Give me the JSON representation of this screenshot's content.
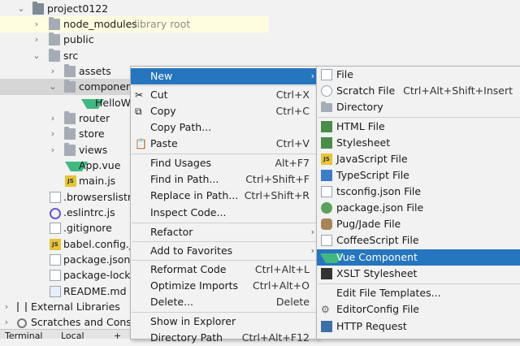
{
  "tree": {
    "rows": [
      {
        "label": "project0122"
      },
      {
        "label": "node_modules",
        "hint": "library root"
      },
      {
        "label": "public"
      },
      {
        "label": "src"
      },
      {
        "label": "assets"
      },
      {
        "label": "component"
      },
      {
        "label": "HelloWo"
      },
      {
        "label": "router"
      },
      {
        "label": "store"
      },
      {
        "label": "views"
      },
      {
        "label": "App.vue"
      },
      {
        "label": "main.js"
      },
      {
        "label": ".browserslistrc"
      },
      {
        "label": ".eslintrc.js"
      },
      {
        "label": ".gitignore"
      },
      {
        "label": "babel.config.js"
      },
      {
        "label": "package.json"
      },
      {
        "label": "package-lock.j"
      },
      {
        "label": "README.md"
      },
      {
        "label": "External Libraries"
      },
      {
        "label": "Scratches and Consol"
      }
    ]
  },
  "bottom": {
    "terminal": "Terminal",
    "local": "Local",
    "plus": "+"
  },
  "menu1": {
    "items": [
      {
        "label": "New",
        "shortcut": "",
        "submenu": "›"
      },
      {
        "label": "Cut",
        "shortcut": "Ctrl+X"
      },
      {
        "label": "Copy",
        "shortcut": "Ctrl+C"
      },
      {
        "label": "Copy Path...",
        "shortcut": ""
      },
      {
        "label": "Paste",
        "shortcut": "Ctrl+V"
      },
      {
        "label": "Find Usages",
        "shortcut": "Alt+F7"
      },
      {
        "label": "Find in Path...",
        "shortcut": "Ctrl+Shift+F"
      },
      {
        "label": "Replace in Path...",
        "shortcut": "Ctrl+Shift+R"
      },
      {
        "label": "Inspect Code...",
        "shortcut": ""
      },
      {
        "label": "Refactor",
        "shortcut": "",
        "submenu": "›"
      },
      {
        "label": "Add to Favorites",
        "shortcut": "",
        "submenu": "›"
      },
      {
        "label": "Reformat Code",
        "shortcut": "Ctrl+Alt+L"
      },
      {
        "label": "Optimize Imports",
        "shortcut": "Ctrl+Alt+O"
      },
      {
        "label": "Delete...",
        "shortcut": "Delete"
      },
      {
        "label": "Show in Explorer",
        "shortcut": ""
      },
      {
        "label": "Directory Path",
        "shortcut": "Ctrl+Alt+F12"
      }
    ]
  },
  "menu2": {
    "items": [
      {
        "label": "File",
        "shortcut": ""
      },
      {
        "label": "Scratch File",
        "shortcut": "Ctrl+Alt+Shift+Insert"
      },
      {
        "label": "Directory",
        "shortcut": ""
      },
      {
        "label": "HTML File",
        "shortcut": ""
      },
      {
        "label": "Stylesheet",
        "shortcut": ""
      },
      {
        "label": "JavaScript File",
        "shortcut": ""
      },
      {
        "label": "TypeScript File",
        "shortcut": ""
      },
      {
        "label": "tsconfig.json File",
        "shortcut": ""
      },
      {
        "label": "package.json File",
        "shortcut": ""
      },
      {
        "label": "Pug/Jade File",
        "shortcut": ""
      },
      {
        "label": "CoffeeScript File",
        "shortcut": ""
      },
      {
        "label": "Vue Component",
        "shortcut": ""
      },
      {
        "label": "XSLT Stylesheet",
        "shortcut": ""
      },
      {
        "label": "Edit File Templates...",
        "shortcut": ""
      },
      {
        "label": "EditorConfig File",
        "shortcut": ""
      },
      {
        "label": "HTTP Request",
        "shortcut": ""
      }
    ]
  },
  "colors": {
    "accent": "#2675bf",
    "menu_bg": "#f2f2f2",
    "vue": "#41b883",
    "selection": "#d5d5d5"
  }
}
